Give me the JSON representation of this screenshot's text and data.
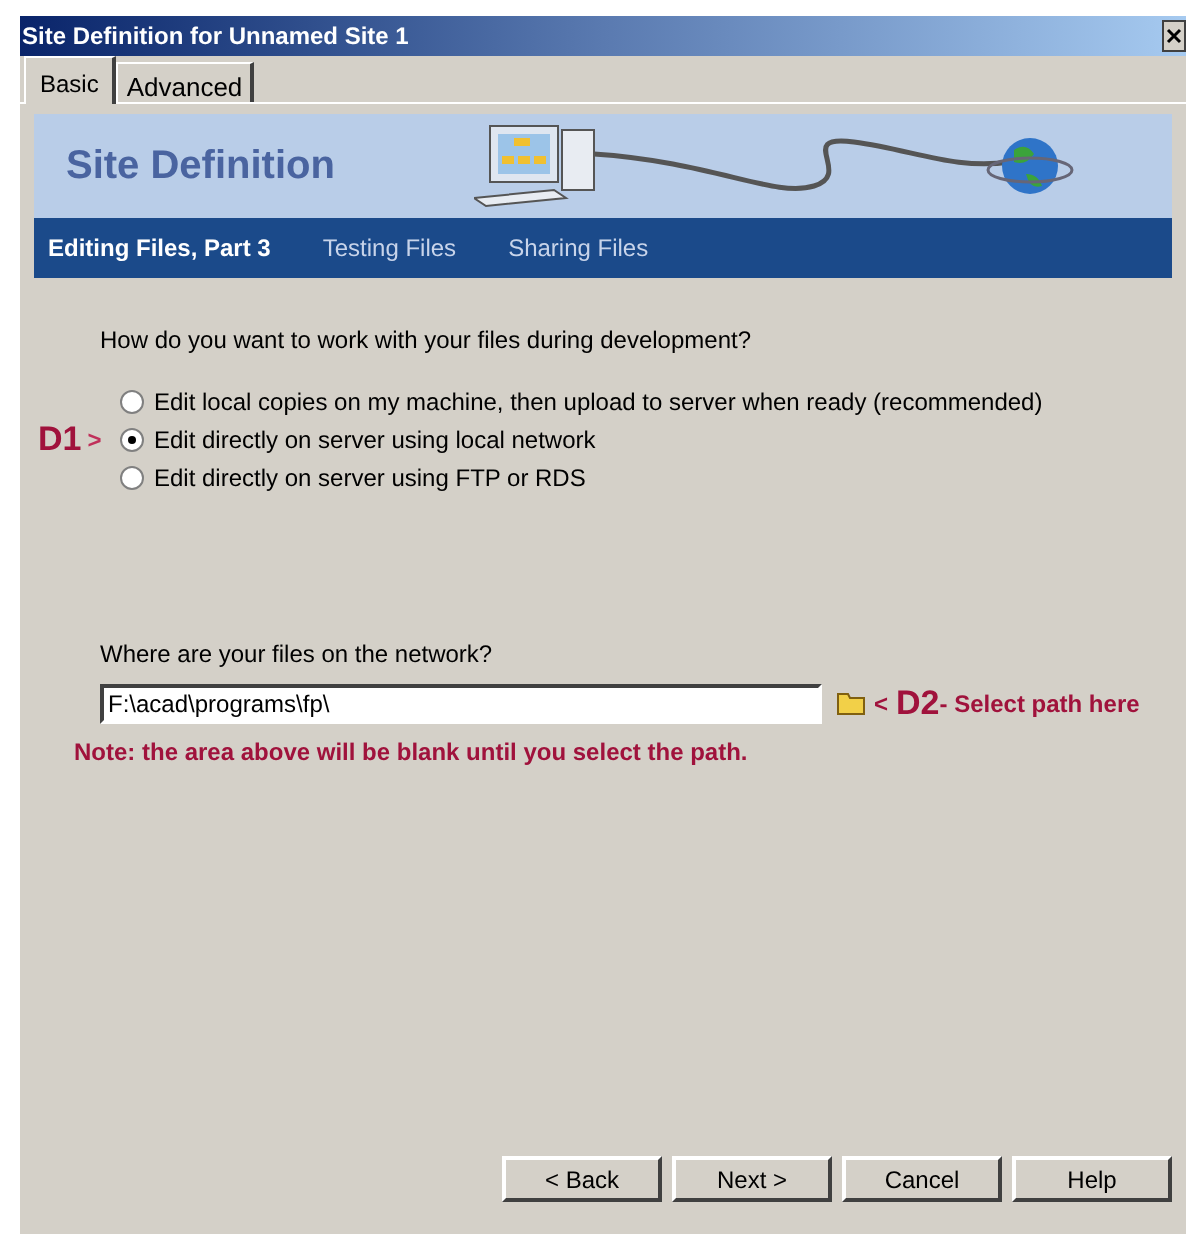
{
  "window": {
    "title": "Site Definition for Unnamed Site 1"
  },
  "tabs": [
    {
      "label": "Basic",
      "selected": true
    },
    {
      "label": "Advanced",
      "selected": false
    }
  ],
  "banner": {
    "title": "Site Definition"
  },
  "steps": [
    {
      "label": "Editing Files, Part 3",
      "selected": true
    },
    {
      "label": "Testing Files",
      "selected": false
    },
    {
      "label": "Sharing Files",
      "selected": false
    }
  ],
  "question": "How do you want to work with your files during development?",
  "options": [
    {
      "label": "Edit local copies on my machine, then upload to server when ready (recommended)",
      "selected": false
    },
    {
      "label": "Edit directly on server using local network",
      "selected": true,
      "annotation": {
        "tag": "D1",
        "pointer": ">"
      }
    },
    {
      "label": "Edit directly on server using FTP or RDS",
      "selected": false
    }
  ],
  "network": {
    "label": "Where are your files on the network?",
    "value": "F:\\acad\\programs\\fp\\",
    "annotation": {
      "pointer": "<",
      "tag": "D2",
      "text": "- Select path here"
    },
    "note": "Note: the area above will be blank until you select the path."
  },
  "buttons": [
    "< Back",
    "Next >",
    "Cancel",
    "Help"
  ]
}
